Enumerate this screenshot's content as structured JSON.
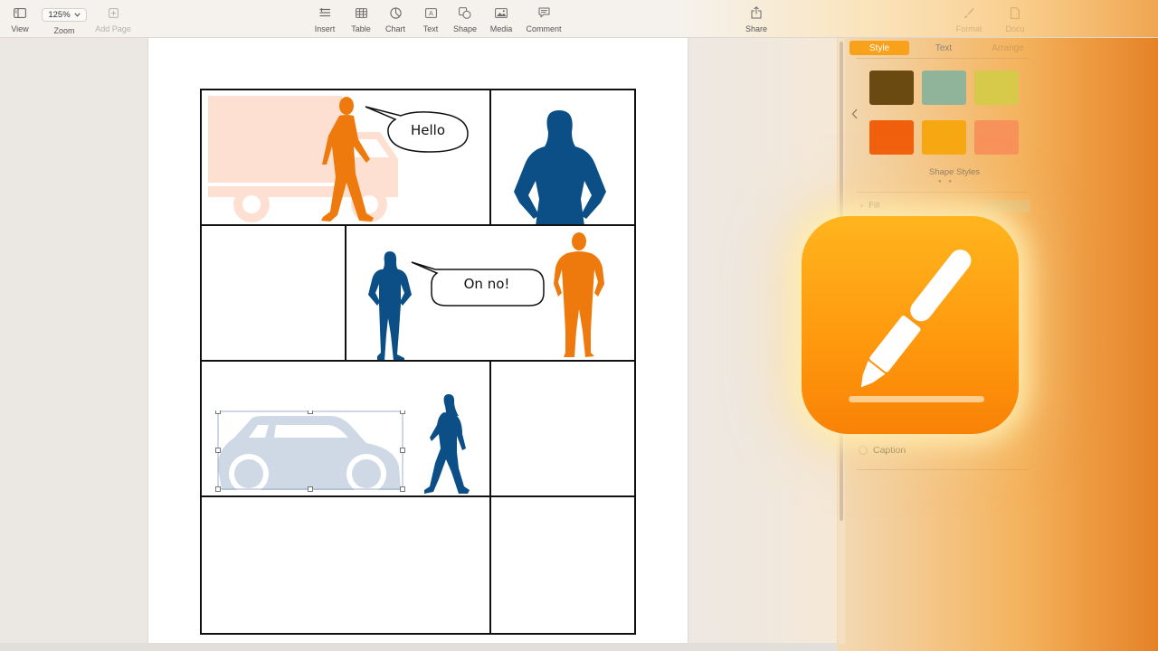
{
  "toolbar": {
    "view_label": "View",
    "zoom_value": "125%",
    "zoom_label": "Zoom",
    "add_page_label": "Add Page",
    "insert_label": "Insert",
    "table_label": "Table",
    "chart_label": "Chart",
    "text_label": "Text",
    "shape_label": "Shape",
    "media_label": "Media",
    "comment_label": "Comment",
    "share_label": "Share",
    "format_label": "Format",
    "document_label": "Docu"
  },
  "document": {
    "bubble_1": "Hello",
    "bubble_2": "On no!"
  },
  "inspector": {
    "tab_style": "Style",
    "tab_text": "Text",
    "tab_arrange": "Arrange",
    "shape_styles_label": "Shape Styles",
    "fill_label": "Fill",
    "caption_label": "Caption",
    "swatch_colors": [
      "#6a4a10",
      "#8fb49a",
      "#d7c94a",
      "#f0600c",
      "#f6a812",
      "#f7925a"
    ]
  },
  "colors": {
    "orange_figure": "#ee7a0e",
    "blue_figure": "#0c4f86",
    "truck": "#fde0d2",
    "car": "#cfd9e6",
    "accent": "#f7a21a"
  }
}
